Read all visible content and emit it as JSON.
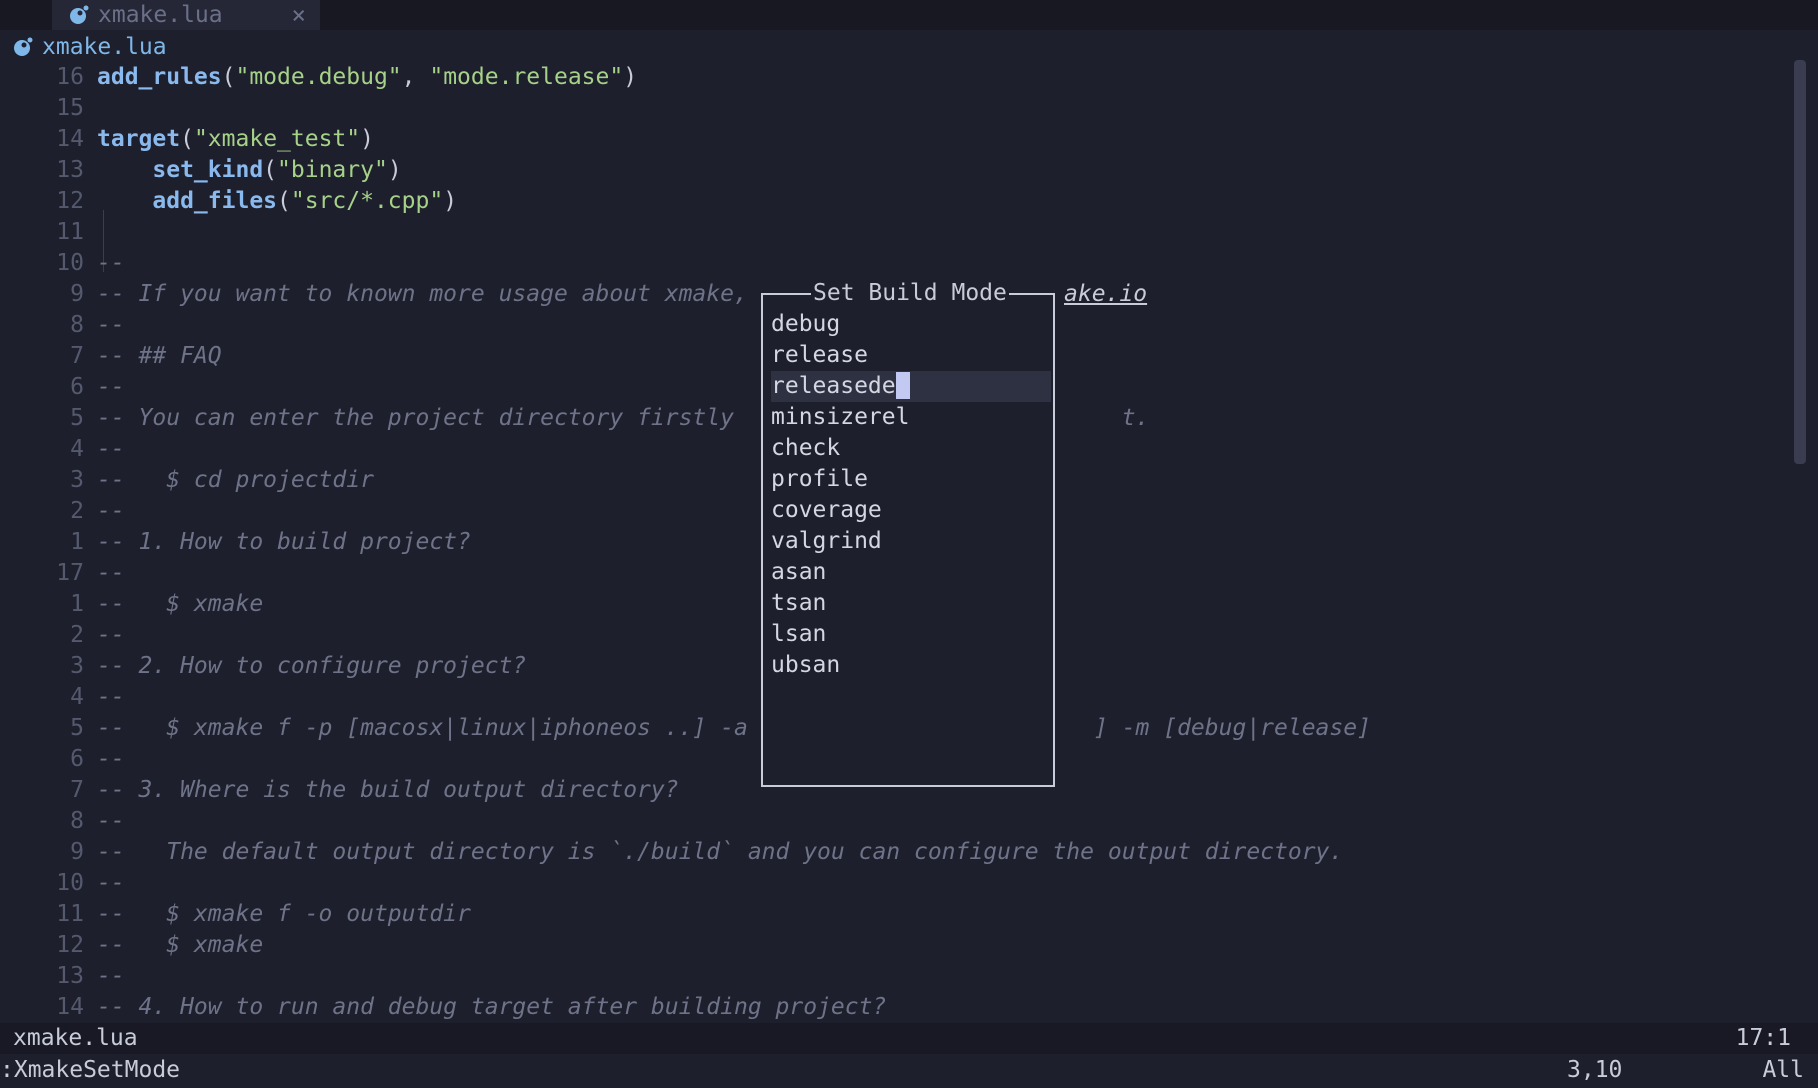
{
  "tab": {
    "title": "xmake.lua",
    "close": "×",
    "icon": "lua-file-icon"
  },
  "winbar": {
    "title": "xmake.lua",
    "icon": "lua-file-icon"
  },
  "colors": {
    "keyword": "#8ab9ee",
    "string": "#a6d189",
    "comment": "#6e7389",
    "background": "#1e1f2c",
    "accent": "#7fb8e8"
  },
  "lines": [
    {
      "num": "16",
      "segs": [
        [
          "k",
          "add_rules"
        ],
        [
          "p",
          "("
        ],
        [
          "s",
          "\"mode.debug\""
        ],
        [
          "p",
          ", "
        ],
        [
          "s",
          "\"mode.release\""
        ],
        [
          "p",
          ")"
        ]
      ]
    },
    {
      "num": "15",
      "segs": []
    },
    {
      "num": "14",
      "segs": [
        [
          "k",
          "target"
        ],
        [
          "p",
          "("
        ],
        [
          "s",
          "\"xmake_test\""
        ],
        [
          "p",
          ")"
        ]
      ]
    },
    {
      "num": "13",
      "segs": [
        [
          "p",
          "    "
        ],
        [
          "k",
          "set_kind"
        ],
        [
          "p",
          "("
        ],
        [
          "s",
          "\"binary\""
        ],
        [
          "p",
          ")"
        ]
      ]
    },
    {
      "num": "12",
      "segs": [
        [
          "p",
          "    "
        ],
        [
          "k",
          "add_files"
        ],
        [
          "p",
          "("
        ],
        [
          "s",
          "\"src/*.cpp\""
        ],
        [
          "p",
          ")"
        ]
      ]
    },
    {
      "num": "11",
      "segs": []
    },
    {
      "num": "10",
      "segs": [
        [
          "c",
          "--"
        ]
      ]
    },
    {
      "num": "9",
      "segs": [
        [
          "c",
          "-- If you want to known more usage about xmake,"
        ]
      ]
    },
    {
      "num": "8",
      "segs": [
        [
          "c",
          "--"
        ]
      ]
    },
    {
      "num": "7",
      "segs": [
        [
          "c",
          "-- ## FAQ"
        ]
      ]
    },
    {
      "num": "6",
      "segs": [
        [
          "c",
          "--"
        ]
      ]
    },
    {
      "num": "5",
      "segs": [
        [
          "c",
          "-- You can enter the project directory firstly                            t."
        ]
      ]
    },
    {
      "num": "4",
      "segs": [
        [
          "c",
          "--"
        ]
      ]
    },
    {
      "num": "3",
      "segs": [
        [
          "c",
          "--   $ cd projectdir"
        ]
      ]
    },
    {
      "num": "2",
      "segs": [
        [
          "c",
          "--"
        ]
      ]
    },
    {
      "num": "1",
      "segs": [
        [
          "c",
          "-- 1. How to build project?"
        ]
      ]
    },
    {
      "num": "17",
      "segs": [
        [
          "c",
          "--"
        ]
      ]
    },
    {
      "num": "1",
      "segs": [
        [
          "c",
          "--   $ xmake"
        ]
      ]
    },
    {
      "num": "2",
      "segs": [
        [
          "c",
          "--"
        ]
      ]
    },
    {
      "num": "3",
      "segs": [
        [
          "c",
          "-- 2. How to configure project?"
        ]
      ]
    },
    {
      "num": "4",
      "segs": [
        [
          "c",
          "--"
        ]
      ]
    },
    {
      "num": "5",
      "segs": [
        [
          "c",
          "--   $ xmake f -p [macosx|linux|iphoneos ..] -a                         ] -m [debug|release]"
        ]
      ]
    },
    {
      "num": "6",
      "segs": [
        [
          "c",
          "--"
        ]
      ]
    },
    {
      "num": "7",
      "segs": [
        [
          "c",
          "-- 3. Where is the build output directory?"
        ]
      ]
    },
    {
      "num": "8",
      "segs": [
        [
          "c",
          "--"
        ]
      ]
    },
    {
      "num": "9",
      "segs": [
        [
          "c",
          "--   The default output directory is `./build` and you can configure the output directory."
        ]
      ]
    },
    {
      "num": "10",
      "segs": [
        [
          "c",
          "--"
        ]
      ]
    },
    {
      "num": "11",
      "segs": [
        [
          "c",
          "--   $ xmake f -o outputdir"
        ]
      ]
    },
    {
      "num": "12",
      "segs": [
        [
          "c",
          "--   $ xmake"
        ]
      ]
    },
    {
      "num": "13",
      "segs": [
        [
          "c",
          "--"
        ]
      ]
    },
    {
      "num": "14",
      "segs": [
        [
          "c",
          "-- 4. How to run and debug target after building project?"
        ]
      ]
    }
  ],
  "url_tail": "ake.io",
  "popup": {
    "title": "Set Build Mode",
    "input_value": "releasede",
    "options": [
      "debug",
      "release",
      "releasede",
      "minsizerel",
      "check",
      "profile",
      "coverage",
      "valgrind",
      "asan",
      "tsan",
      "lsan",
      "ubsan"
    ],
    "selected_index": 2
  },
  "statusline": {
    "filename": "xmake.lua",
    "position": "17:1"
  },
  "cmdline": {
    "command": ":XmakeSetMode",
    "cursor_pos": "3,10",
    "scroll": "All"
  }
}
